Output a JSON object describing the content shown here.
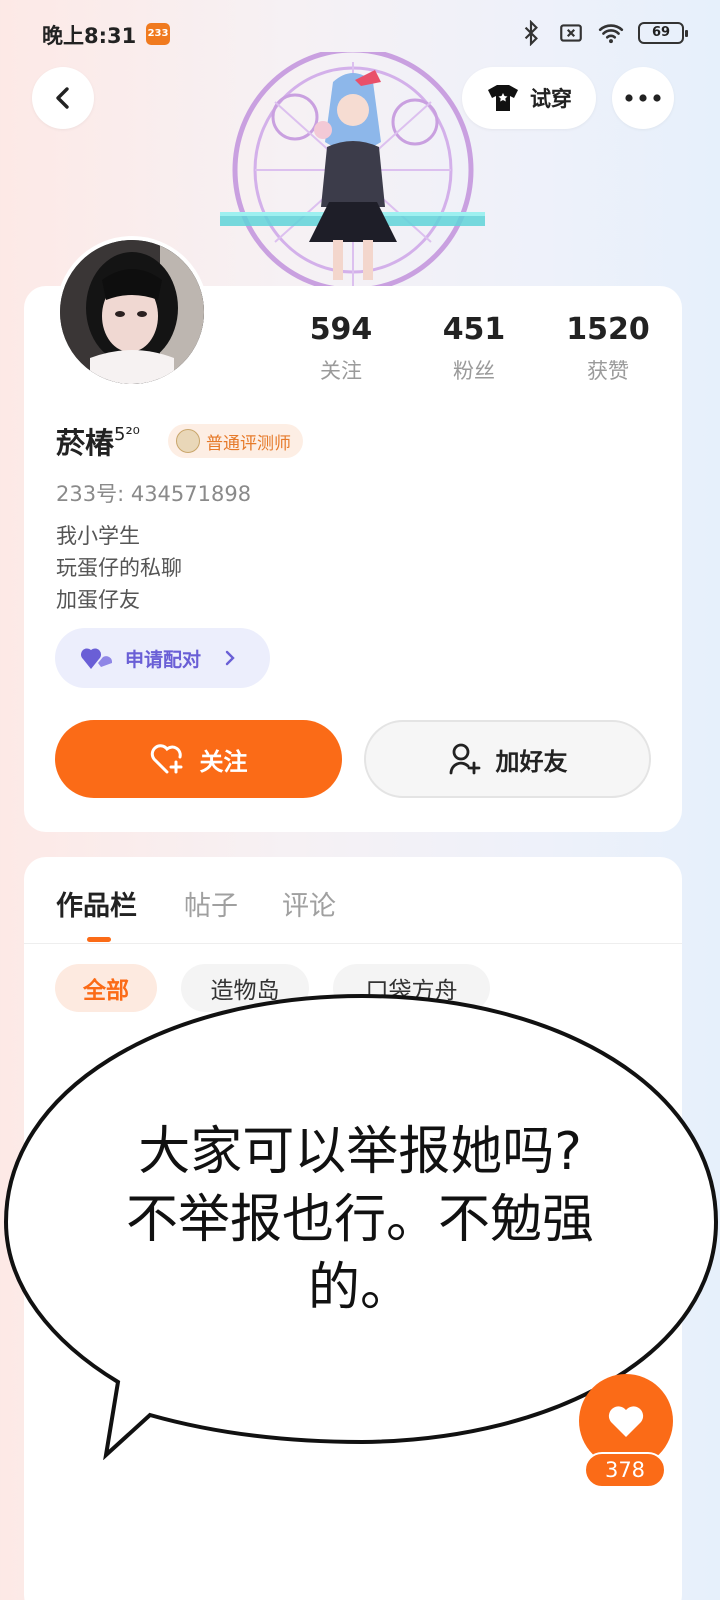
{
  "status_bar": {
    "time": "晚上8:31",
    "app_badge": "233",
    "battery": "69",
    "icons": [
      "bluetooth-icon",
      "sim-off-icon",
      "wifi-icon",
      "battery-icon"
    ]
  },
  "nav": {
    "try_on_label": "试穿",
    "icons": [
      "back-arrow-icon",
      "tshirt-icon",
      "more-dots-icon"
    ]
  },
  "profile": {
    "stats": [
      {
        "value": "594",
        "label": "关注"
      },
      {
        "value": "451",
        "label": "粉丝"
      },
      {
        "value": "1520",
        "label": "获赞"
      }
    ],
    "name": "菸椿",
    "name_superscript": "5²⁰",
    "badge": "普通评测师",
    "user_id": "233号: 434571898",
    "bio": [
      "我小学生",
      "玩蛋仔的私聊",
      "加蛋仔友"
    ],
    "pair_label": "申请配对",
    "follow_label": "关注",
    "add_friend_label": "加好友"
  },
  "works": {
    "tabs": [
      "作品栏",
      "帖子",
      "评论"
    ],
    "active_tab": "作品栏",
    "chips": [
      "全部",
      "造物岛",
      "口袋方舟"
    ],
    "active_chip": "全部"
  },
  "overlay": {
    "speech_lines": [
      "大家可以举报她吗?",
      "不举报也行。不勉强",
      "的。"
    ]
  },
  "like": {
    "count": "378"
  },
  "colors": {
    "accent": "#fb6b17",
    "pair_purple": "#6a5fd6"
  }
}
